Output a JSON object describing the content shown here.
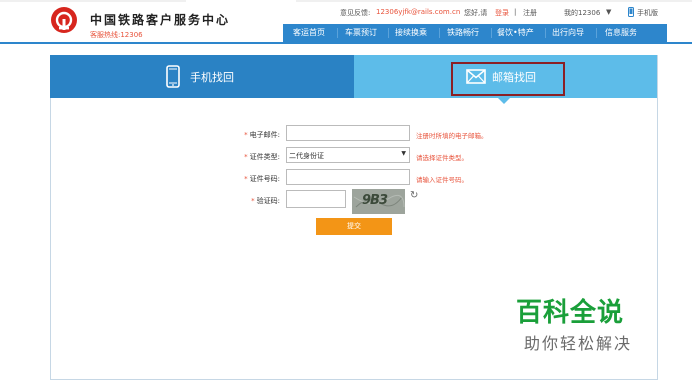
{
  "header": {
    "site_title": "中国铁路客户服务中心",
    "hotline": "客服热线:12306",
    "topbar": {
      "feedback_label": "意见反馈:",
      "feedback_email": "12306yjfk@rails.com.cn",
      "greeting": "您好,请",
      "login": "登录",
      "divider": "|",
      "register": "注册",
      "my12306": "我的12306",
      "caret": "▼",
      "mobile": "手机版"
    },
    "nav": [
      "客运首页",
      "车票预订",
      "接续换乘",
      "铁路畅行",
      "餐饮•特产",
      "出行向导",
      "信息服务"
    ]
  },
  "tabs": {
    "phone": "手机找回",
    "email": "邮箱找回"
  },
  "form": {
    "email_label": "电子邮件:",
    "email_hint": "注册时所填的电子邮箱。",
    "idtype_label": "证件类型:",
    "idtype_value": "二代身份证",
    "idtype_hint": "请选择证件类型。",
    "idno_label": "证件号码:",
    "idno_hint": "请输入证件号码。",
    "captcha_label": "验证码:",
    "captcha_text": "9B3",
    "submit": "提交",
    "required_mark": "*",
    "select_arrow": "▼",
    "refresh_glyph": "↻"
  },
  "watermark": {
    "main": "百科全说",
    "sub": "助你轻松解决"
  },
  "colors": {
    "brand_blue": "#2d86cc",
    "tab_active": "#5dbce9",
    "accent_orange": "#f39516",
    "logo_red": "#d7261e",
    "highlight": "#8b1f24"
  }
}
